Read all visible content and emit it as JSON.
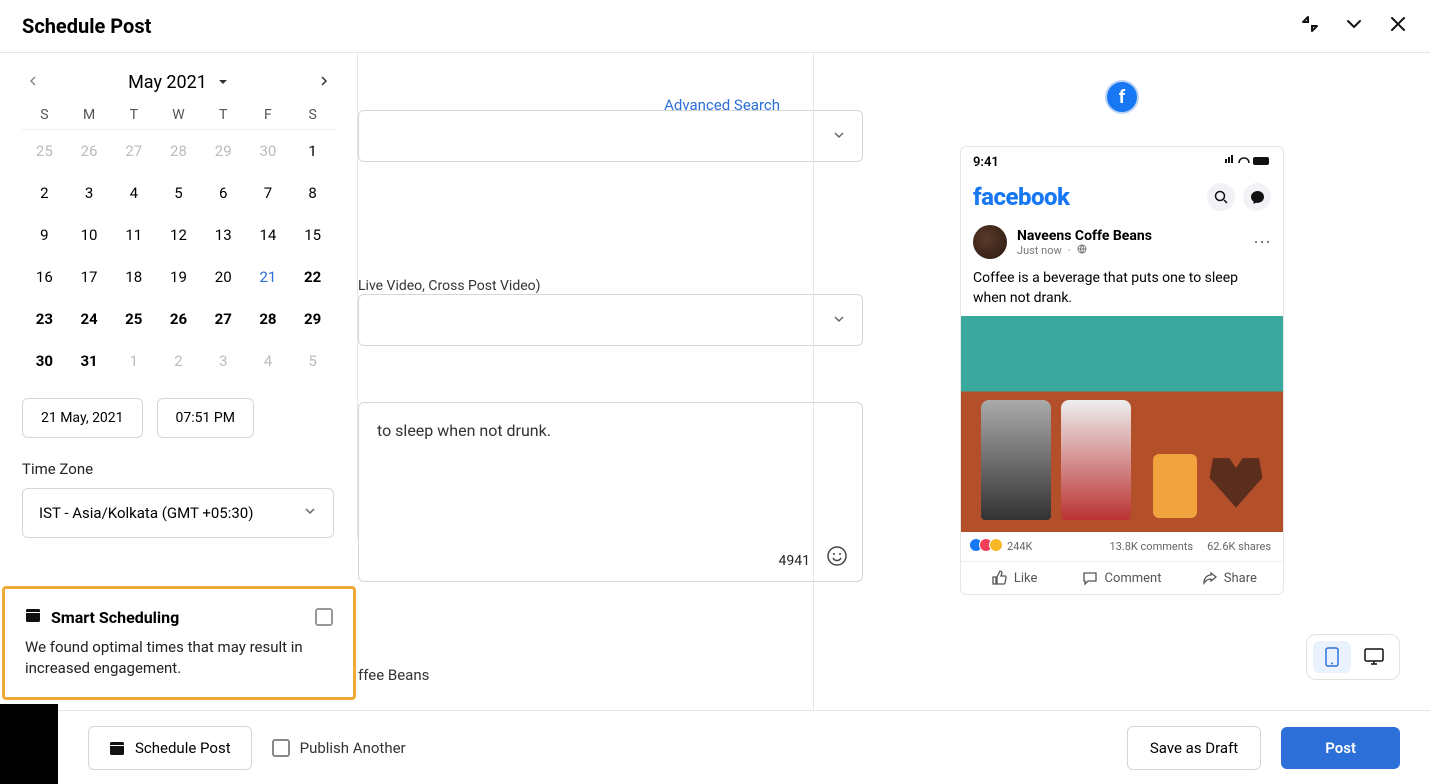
{
  "header": {
    "title": "Schedule Post"
  },
  "form": {
    "advanced_search": "Advanced Search",
    "video_note": "Live Video, Cross Post Video)",
    "message": "to sleep when not drunk.",
    "char_count": "4941",
    "image_chip": "ffee Beans"
  },
  "calendar": {
    "month_label": "May 2021",
    "dow": [
      "S",
      "M",
      "T",
      "W",
      "T",
      "F",
      "S"
    ],
    "cells": [
      {
        "d": "25",
        "muted": true
      },
      {
        "d": "26",
        "muted": true
      },
      {
        "d": "27",
        "muted": true
      },
      {
        "d": "28",
        "muted": true
      },
      {
        "d": "29",
        "muted": true
      },
      {
        "d": "30",
        "muted": true
      },
      {
        "d": "1"
      },
      {
        "d": "2"
      },
      {
        "d": "3"
      },
      {
        "d": "4"
      },
      {
        "d": "5"
      },
      {
        "d": "6"
      },
      {
        "d": "7"
      },
      {
        "d": "8"
      },
      {
        "d": "9"
      },
      {
        "d": "10"
      },
      {
        "d": "11"
      },
      {
        "d": "12"
      },
      {
        "d": "13"
      },
      {
        "d": "14"
      },
      {
        "d": "15"
      },
      {
        "d": "16"
      },
      {
        "d": "17"
      },
      {
        "d": "18"
      },
      {
        "d": "19"
      },
      {
        "d": "20"
      },
      {
        "d": "21",
        "today": true
      },
      {
        "d": "22",
        "bold": true
      },
      {
        "d": "23",
        "bold": true
      },
      {
        "d": "24",
        "bold": true
      },
      {
        "d": "25",
        "bold": true
      },
      {
        "d": "26",
        "bold": true
      },
      {
        "d": "27",
        "bold": true
      },
      {
        "d": "28",
        "bold": true
      },
      {
        "d": "29",
        "bold": true
      },
      {
        "d": "30",
        "bold": true
      },
      {
        "d": "31",
        "bold": true
      },
      {
        "d": "1",
        "muted": true
      },
      {
        "d": "2",
        "muted": true
      },
      {
        "d": "3",
        "muted": true
      },
      {
        "d": "4",
        "muted": true
      },
      {
        "d": "5",
        "muted": true
      }
    ],
    "date_value": "21 May, 2021",
    "time_value": "07:51 PM",
    "tz_label": "Time Zone",
    "tz_value": "IST - Asia/Kolkata (GMT +05:30)"
  },
  "smart": {
    "title": "Smart Scheduling",
    "desc": "We found optimal times that may result in increased engagement."
  },
  "preview": {
    "status_time": "9:41",
    "fb_logo": "facebook",
    "post_name": "Naveens Coffe Beans",
    "post_sub": "Just now",
    "post_body": "Coffee is a beverage that puts one to sleep when not drank.",
    "likes": "244K",
    "comments": "13.8K comments",
    "shares": "62.6K shares",
    "like_label": "Like",
    "comment_label": "Comment",
    "share_label": "Share"
  },
  "footer": {
    "schedule": "Schedule Post",
    "publish_another": "Publish Another",
    "draft": "Save as Draft",
    "post": "Post"
  }
}
